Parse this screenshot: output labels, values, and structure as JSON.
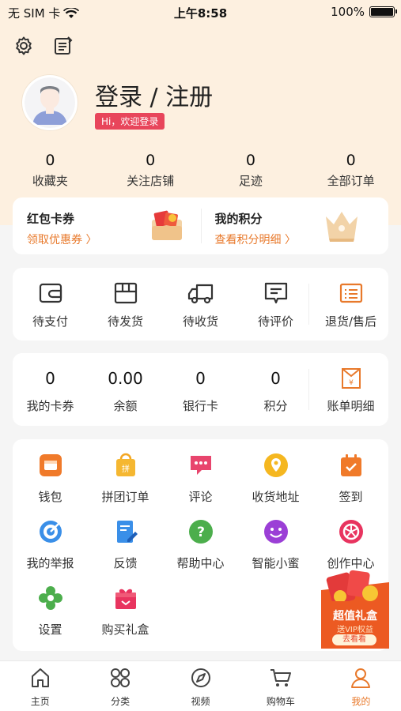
{
  "status": {
    "carrier": "无 SIM 卡",
    "time": "上午8:58",
    "battery": "100%"
  },
  "profile": {
    "login_text": "登录 / 注册",
    "welcome": "Hi，欢迎登录"
  },
  "stats": [
    {
      "value": "0",
      "label": "收藏夹"
    },
    {
      "value": "0",
      "label": "关注店铺"
    },
    {
      "value": "0",
      "label": "足迹"
    },
    {
      "value": "0",
      "label": "全部订单"
    }
  ],
  "promo": {
    "coupon": {
      "title": "红包卡券",
      "link": "领取优惠券 〉"
    },
    "points": {
      "title": "我的积分",
      "link": "查看积分明细 〉"
    }
  },
  "orders": [
    {
      "label": "待支付",
      "icon": "wallet-icon"
    },
    {
      "label": "待发货",
      "icon": "box-icon"
    },
    {
      "label": "待收货",
      "icon": "truck-icon"
    },
    {
      "label": "待评价",
      "icon": "comment-icon"
    },
    {
      "label": "退货/售后",
      "icon": "return-icon"
    }
  ],
  "wallet": [
    {
      "value": "0",
      "label": "我的卡券"
    },
    {
      "value": "0.00",
      "label": "余额"
    },
    {
      "value": "0",
      "label": "银行卡"
    },
    {
      "value": "0",
      "label": "积分"
    }
  ],
  "wallet_bill": {
    "label": "账单明细",
    "icon": "bill-icon"
  },
  "services": [
    {
      "label": "钱包",
      "icon": "wallet-app-icon"
    },
    {
      "label": "拼团订单",
      "icon": "group-buy-icon"
    },
    {
      "label": "评论",
      "icon": "chat-icon"
    },
    {
      "label": "收货地址",
      "icon": "location-icon"
    },
    {
      "label": "签到",
      "icon": "calendar-check-icon"
    },
    {
      "label": "我的举报",
      "icon": "target-icon"
    },
    {
      "label": "反馈",
      "icon": "feedback-icon"
    },
    {
      "label": "帮助中心",
      "icon": "help-icon"
    },
    {
      "label": "智能小蜜",
      "icon": "smiley-icon"
    },
    {
      "label": "创作中心",
      "icon": "aperture-icon"
    },
    {
      "label": "设置",
      "icon": "flower-gear-icon"
    },
    {
      "label": "购买礼盒",
      "icon": "gift-icon"
    }
  ],
  "float_ad": {
    "title": "超值礼盒",
    "sub": "送VIP权益",
    "btn": "去看看"
  },
  "tabs": [
    {
      "label": "主页",
      "icon": "home-icon"
    },
    {
      "label": "分类",
      "icon": "category-icon"
    },
    {
      "label": "视频",
      "icon": "compass-icon"
    },
    {
      "label": "购物车",
      "icon": "cart-icon"
    },
    {
      "label": "我的",
      "icon": "user-icon",
      "active": true
    }
  ],
  "colors": {
    "accent": "#e8792b",
    "badge": "#e8455b",
    "header_bg": "#fdf0e0"
  }
}
